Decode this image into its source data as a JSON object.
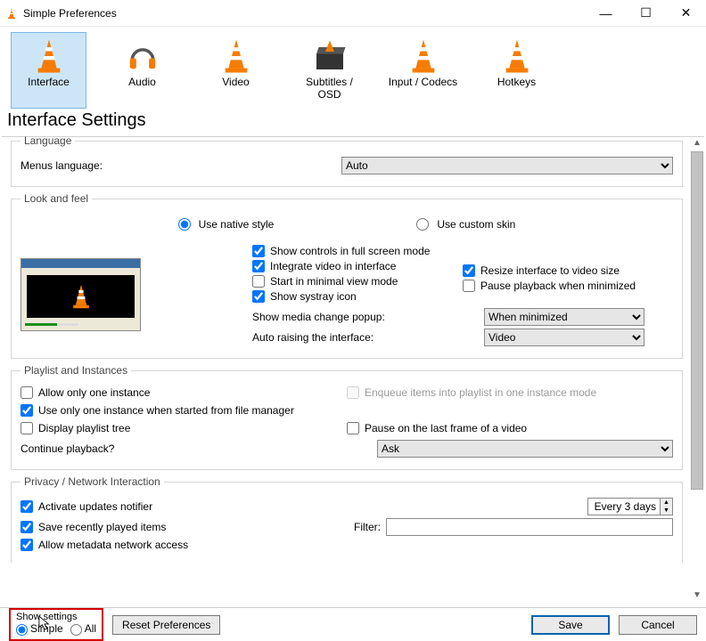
{
  "window": {
    "title": "Simple Preferences"
  },
  "tabs": [
    {
      "label": "Interface"
    },
    {
      "label": "Audio"
    },
    {
      "label": "Video"
    },
    {
      "label": "Subtitles / OSD"
    },
    {
      "label": "Input / Codecs"
    },
    {
      "label": "Hotkeys"
    }
  ],
  "page": {
    "title": "Interface Settings"
  },
  "language": {
    "legend": "Language",
    "menus_label": "Menus language:",
    "value": "Auto"
  },
  "look": {
    "legend": "Look and feel",
    "native": "Use native style",
    "custom": "Use custom skin",
    "show_controls": "Show controls in full screen mode",
    "integrate": "Integrate video in interface",
    "resize": "Resize interface to video size",
    "minimal": "Start in minimal view mode",
    "pause_min": "Pause playback when minimized",
    "systray": "Show systray icon",
    "popup_label": "Show media change popup:",
    "popup_value": "When minimized",
    "raise_label": "Auto raising the interface:",
    "raise_value": "Video"
  },
  "playlist": {
    "legend": "Playlist and Instances",
    "one_instance": "Allow only one instance",
    "enqueue": "Enqueue items into playlist in one instance mode",
    "one_instance_fm": "Use only one instance when started from file manager",
    "tree": "Display playlist tree",
    "pause_last": "Pause on the last frame of a video",
    "continue_label": "Continue playback?",
    "continue_value": "Ask"
  },
  "privacy": {
    "legend": "Privacy / Network Interaction",
    "updates": "Activate updates notifier",
    "updates_value": "Every 3 days",
    "recent": "Save recently played items",
    "filter_label": "Filter:",
    "filter_value": "",
    "metadata": "Allow metadata network access"
  },
  "footer": {
    "show_settings": "Show settings",
    "simple": "Simple",
    "all": "All",
    "reset": "Reset Preferences",
    "save": "Save",
    "cancel": "Cancel"
  }
}
